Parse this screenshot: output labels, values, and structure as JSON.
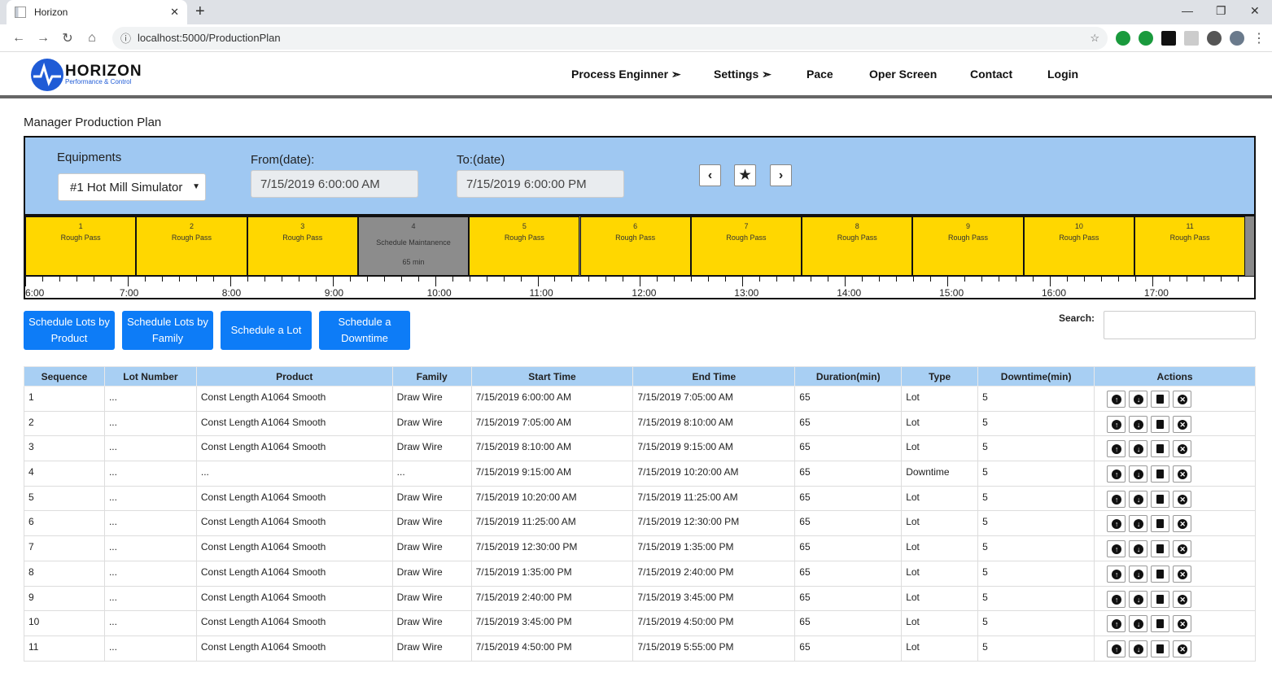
{
  "browser": {
    "tab_title": "Horizon",
    "tab_close": "✕",
    "new_tab": "+",
    "url": "localhost:5000/ProductionPlan",
    "win_min": "—",
    "win_restore": "❐",
    "win_close": "✕"
  },
  "nav": {
    "logo_main": "HORIZON",
    "logo_sub": "Performance & Control",
    "items": [
      "Process Enginner ➣",
      "Settings ➣",
      "Pace",
      "Oper Screen",
      "Contact",
      "Login"
    ]
  },
  "page": {
    "title": "Manager Production Plan"
  },
  "filters": {
    "equipment_label": "Equipments",
    "equipment_value": "#1 Hot Mill Simulator",
    "from_label": "From(date):",
    "from_value": "7/15/2019 6:00:00 AM",
    "to_label": "To:(date)",
    "to_value": "7/15/2019 6:00:00 PM",
    "prev_icon": "chevron-left-icon",
    "star_icon": "star-icon",
    "next_icon": "chevron-right-icon"
  },
  "timeline": {
    "blocks": [
      {
        "num": "1",
        "label": "Rough Pass",
        "extra": "",
        "type": "lot"
      },
      {
        "num": "2",
        "label": "Rough Pass",
        "extra": "",
        "type": "lot"
      },
      {
        "num": "3",
        "label": "Rough Pass",
        "extra": "",
        "type": "lot"
      },
      {
        "num": "4",
        "label": "Schedule Maintanence",
        "extra": "65 min",
        "type": "down"
      },
      {
        "num": "5",
        "label": "Rough Pass",
        "extra": "",
        "type": "lot"
      },
      {
        "num": "6",
        "label": "Rough Pass",
        "extra": "",
        "type": "lot"
      },
      {
        "num": "7",
        "label": "Rough Pass",
        "extra": "",
        "type": "lot"
      },
      {
        "num": "8",
        "label": "Rough Pass",
        "extra": "",
        "type": "lot"
      },
      {
        "num": "9",
        "label": "Rough Pass",
        "extra": "",
        "type": "lot"
      },
      {
        "num": "10",
        "label": "Rough Pass",
        "extra": "",
        "type": "lot"
      },
      {
        "num": "11",
        "label": "Rough Pass",
        "extra": "",
        "type": "lot"
      }
    ],
    "hours": [
      "6:00",
      "7:00",
      "8:00",
      "9:00",
      "10:00",
      "11:00",
      "12:00",
      "13:00",
      "14:00",
      "15:00",
      "16:00",
      "17:00"
    ]
  },
  "buttons": {
    "by_product": "Schedule Lots by Product",
    "by_family": "Schedule Lots by Family",
    "a_lot": "Schedule a Lot",
    "downtime": "Schedule a Downtime"
  },
  "search": {
    "label": "Search:",
    "value": ""
  },
  "table": {
    "headers": [
      "Sequence",
      "Lot Number",
      "Product",
      "Family",
      "Start Time",
      "End Time",
      "Duration(min)",
      "Type",
      "Downtime(min)",
      "Actions"
    ],
    "rows": [
      [
        "1",
        "...",
        "Const Length A1064 Smooth",
        "Draw Wire",
        "7/15/2019 6:00:00 AM",
        "7/15/2019 7:05:00 AM",
        "65",
        "Lot",
        "5"
      ],
      [
        "2",
        "...",
        "Const Length A1064 Smooth",
        "Draw Wire",
        "7/15/2019 7:05:00 AM",
        "7/15/2019 8:10:00 AM",
        "65",
        "Lot",
        "5"
      ],
      [
        "3",
        "...",
        "Const Length A1064 Smooth",
        "Draw Wire",
        "7/15/2019 8:10:00 AM",
        "7/15/2019 9:15:00 AM",
        "65",
        "Lot",
        "5"
      ],
      [
        "4",
        "...",
        "...",
        "...",
        "7/15/2019 9:15:00 AM",
        "7/15/2019 10:20:00 AM",
        "65",
        "Downtime",
        "5"
      ],
      [
        "5",
        "...",
        "Const Length A1064 Smooth",
        "Draw Wire",
        "7/15/2019 10:20:00 AM",
        "7/15/2019 11:25:00 AM",
        "65",
        "Lot",
        "5"
      ],
      [
        "6",
        "...",
        "Const Length A1064 Smooth",
        "Draw Wire",
        "7/15/2019 11:25:00 AM",
        "7/15/2019 12:30:00 PM",
        "65",
        "Lot",
        "5"
      ],
      [
        "7",
        "...",
        "Const Length A1064 Smooth",
        "Draw Wire",
        "7/15/2019 12:30:00 PM",
        "7/15/2019 1:35:00 PM",
        "65",
        "Lot",
        "5"
      ],
      [
        "8",
        "...",
        "Const Length A1064 Smooth",
        "Draw Wire",
        "7/15/2019 1:35:00 PM",
        "7/15/2019 2:40:00 PM",
        "65",
        "Lot",
        "5"
      ],
      [
        "9",
        "...",
        "Const Length A1064 Smooth",
        "Draw Wire",
        "7/15/2019 2:40:00 PM",
        "7/15/2019 3:45:00 PM",
        "65",
        "Lot",
        "5"
      ],
      [
        "10",
        "...",
        "Const Length A1064 Smooth",
        "Draw Wire",
        "7/15/2019 3:45:00 PM",
        "7/15/2019 4:50:00 PM",
        "65",
        "Lot",
        "5"
      ],
      [
        "11",
        "...",
        "Const Length A1064 Smooth",
        "Draw Wire",
        "7/15/2019 4:50:00 PM",
        "7/15/2019 5:55:00 PM",
        "65",
        "Lot",
        "5"
      ]
    ],
    "action_icons": [
      "move-up-icon",
      "move-down-icon",
      "save-icon",
      "delete-icon"
    ]
  },
  "colors": {
    "panel_bg": "#9fc8f2",
    "lot_block": "#ffd700",
    "downtime_block": "#8c8c8c",
    "button_blue": "#0d7cf7",
    "table_header": "#a8cff3"
  }
}
